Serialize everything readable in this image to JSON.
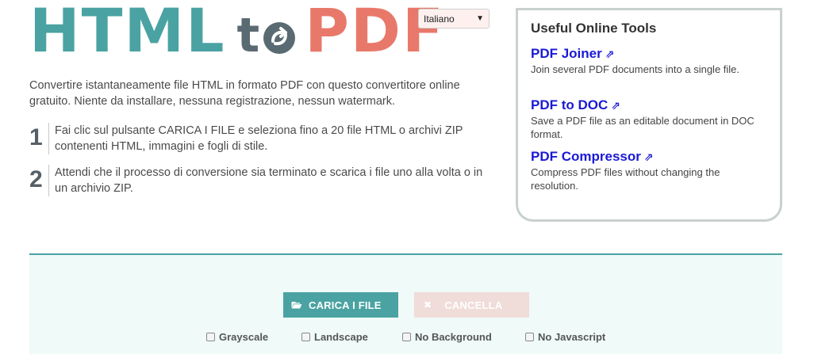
{
  "logo": {
    "html": "HTML",
    "to": "t",
    "pdf": "PDF",
    "colors": {
      "html": "#4aa3a2",
      "to": "#5a6a73",
      "pdf": "#e8796a"
    }
  },
  "language": {
    "selected": "Italiano"
  },
  "intro": "Convertire istantaneamente file HTML in formato PDF con questo convertitore online gratuito. Niente da installare, nessuna registrazione, nessun watermark.",
  "steps": [
    {
      "number": "1",
      "text": "Fai clic sul pulsante CARICA I FILE e seleziona fino a 20 file HTML o archivi ZIP contenenti HTML, immagini e fogli di stile."
    },
    {
      "number": "2",
      "text": "Attendi che il processo di conversione sia terminato e scarica i file uno alla volta o in un archivio ZIP."
    }
  ],
  "tools": {
    "title": "Useful Online Tools",
    "items": [
      {
        "label": "PDF Joiner",
        "icon": "external-link-icon",
        "description": "Join several PDF documents into a single file."
      },
      {
        "label": "PDF to DOC",
        "icon": "external-link-icon",
        "description": "Save a PDF file as an editable document in DOC format."
      },
      {
        "label": "PDF Compressor",
        "icon": "external-link-icon",
        "description": "Compress PDF files without changing the resolution."
      }
    ]
  },
  "upload": {
    "upload_label": "CARICA I FILE",
    "upload_icon": "folder-open-icon",
    "cancel_label": "CANCELLA",
    "cancel_icon": "close-icon",
    "accent": "#4aa3a2",
    "options": [
      {
        "label": "Grayscale",
        "checked": false
      },
      {
        "label": "Landscape",
        "checked": false
      },
      {
        "label": "No Background",
        "checked": false
      },
      {
        "label": "No Javascript",
        "checked": false
      }
    ]
  }
}
